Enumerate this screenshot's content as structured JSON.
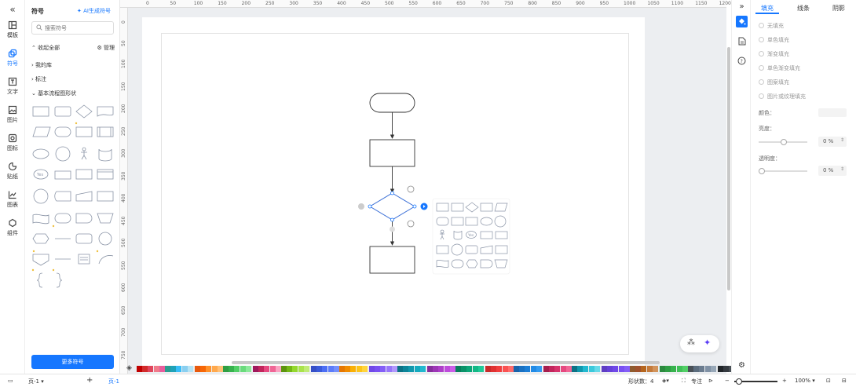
{
  "left_rail": {
    "collapse_icon": "double-chevron-left-icon",
    "items": [
      {
        "label": "模板",
        "icon": "template-icon"
      },
      {
        "label": "符号",
        "icon": "symbol-icon",
        "active": true
      },
      {
        "label": "文字",
        "icon": "text-icon"
      },
      {
        "label": "图片",
        "icon": "image-icon"
      },
      {
        "label": "图标",
        "icon": "icon-icon"
      },
      {
        "label": "贴纸",
        "icon": "sticker-icon"
      },
      {
        "label": "图表",
        "icon": "chart-icon"
      },
      {
        "label": "组件",
        "icon": "component-icon"
      }
    ]
  },
  "symbols_panel": {
    "title": "符号",
    "ai_label": "AI生成符号",
    "search_placeholder": "搜索符号",
    "collapse_all": "收起全部",
    "manage": "管理",
    "groups": [
      {
        "label": "我的库",
        "expanded": false
      },
      {
        "label": "标注",
        "expanded": false
      },
      {
        "label": "基本流程图形状",
        "expanded": true
      }
    ],
    "more_button": "更多符号"
  },
  "ruler": {
    "top_ticks": [
      "0",
      "50",
      "100",
      "150",
      "200",
      "250",
      "300",
      "350",
      "400",
      "450",
      "500",
      "550",
      "600",
      "650",
      "700",
      "750",
      "800",
      "850",
      "900",
      "950",
      "1000",
      "1050",
      "1100",
      "1150",
      "1200"
    ],
    "left_ticks": [
      "0",
      "50",
      "100",
      "150",
      "200",
      "250",
      "300",
      "350",
      "400",
      "450",
      "500",
      "550",
      "600",
      "650",
      "700",
      "750"
    ]
  },
  "palette": {
    "colors": [
      "#c00000",
      "#d22b2b",
      "#e0455c",
      "#f07b8a",
      "#e85d9c",
      "#2a9d8f",
      "#1fa2b8",
      "#38bdf8",
      "#89cff0",
      "#b6e3f4",
      "#e8590c",
      "#f76707",
      "#ff922b",
      "#ffa94d",
      "#ffc078",
      "#2f9e44",
      "#37b24d",
      "#51cf66",
      "#69db7c",
      "#8ce99a",
      "#a0185c",
      "#c2255c",
      "#e64980",
      "#f06595",
      "#faa2c1",
      "#5c940d",
      "#74b816",
      "#94d82d",
      "#a9e34b",
      "#c0eb75",
      "#364fc7",
      "#3b5bdb",
      "#4c6ef5",
      "#5c7cfa",
      "#748ffc",
      "#e67700",
      "#f08c00",
      "#fab005",
      "#fcc419",
      "#ffd43b",
      "#7048e8",
      "#7950f2",
      "#845ef7",
      "#9775fa",
      "#b197fc",
      "#0b7285",
      "#0c8599",
      "#1098ad",
      "#15aabf",
      "#22b8cf",
      "#862e9c",
      "#9c36b5",
      "#ae3ec9",
      "#be4bdb",
      "#cc5de8",
      "#087f5b",
      "#099268",
      "#0ca678",
      "#12b886",
      "#20c997",
      "#c92a2a",
      "#e03131",
      "#f03e3e",
      "#fa5252",
      "#ff6b6b",
      "#1864ab",
      "#1971c2",
      "#1c7ed6",
      "#228be6",
      "#339af0",
      "#a61e4d",
      "#c2255c",
      "#d6336c",
      "#e64980",
      "#f06595",
      "#0b7285",
      "#1098ad",
      "#22b8cf",
      "#3bc9db",
      "#66d9e8",
      "#5f3dc4",
      "#6741d9",
      "#7048e8",
      "#7950f2",
      "#845ef7",
      "#8f5b2e",
      "#a0522d",
      "#b5651d",
      "#c47a3a",
      "#d2935a",
      "#2b8a3e",
      "#2f9e44",
      "#37b24d",
      "#40c057",
      "#51cf66",
      "#495057",
      "#5c6d7e",
      "#6b7c8f",
      "#8091a5",
      "#98a8b8",
      "#212529",
      "#343a40",
      "#495057",
      "#868e96",
      "#adb5bd",
      "#ced4da",
      "#dee2e6",
      "#f1f3f5"
    ]
  },
  "status_bar": {
    "page_select": "页-1",
    "add_page": "+",
    "active_page": "页-1",
    "shape_count": "形状数：4",
    "focus_label": "专注",
    "zoom": "100%"
  },
  "right_rail": {
    "collapse_icon": "double-chevron-right-icon",
    "items": [
      {
        "icon": "fill-bucket-icon",
        "active": true
      },
      {
        "icon": "page-icon"
      },
      {
        "icon": "help-icon"
      }
    ],
    "settings_icon": "gear-icon"
  },
  "props_panel": {
    "tabs": [
      "填充",
      "线条",
      "阴影"
    ],
    "active_tab": 0,
    "fill_options": [
      "无填充",
      "单色填充",
      "渐变填充",
      "单色渐变填充",
      "图案填充",
      "图片或纹理填充"
    ],
    "color_label": "颜色：",
    "brightness_label": "亮度：",
    "brightness_value": "0 %",
    "opacity_label": "透明度：",
    "opacity_value": "0 %"
  },
  "fab_icons": [
    "sparkle-settings-icon",
    "ai-sparkle-icon"
  ]
}
